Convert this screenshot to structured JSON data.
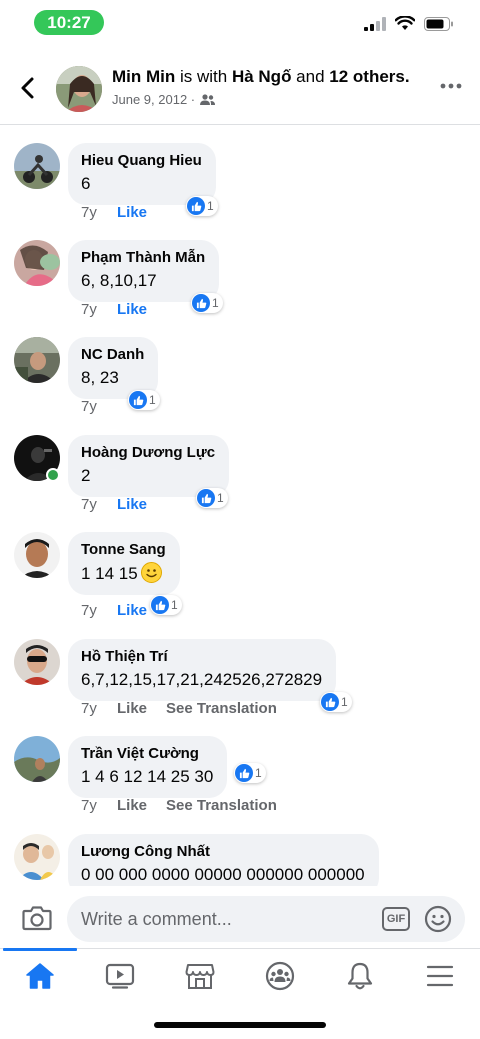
{
  "status_bar": {
    "time": "10:27"
  },
  "header": {
    "poster_name": "Min Min",
    "with_text": " is with ",
    "tagged_name": "Hà Ngố",
    "and_text": " and ",
    "others_text": "12 others.",
    "date": "June 9, 2012 ·",
    "privacy_icon": "friends-icon",
    "back_icon": "chevron-left-icon",
    "more_icon": "ellipsis-icon"
  },
  "comments": [
    {
      "name": "Hieu Quang Hieu",
      "text": "6",
      "age": "7y",
      "like_label": "Like",
      "reaction_count": "1"
    },
    {
      "name": "Phạm Thành Mẫn",
      "text": "6, 8,10,17",
      "age": "7y",
      "like_label": "Like",
      "reaction_count": "1"
    },
    {
      "name": "NC Danh",
      "text": "8, 23",
      "age": "7y",
      "like_label": "",
      "reaction_count": "1"
    },
    {
      "name": "Hoàng Dương Lực",
      "text": "2",
      "age": "7y",
      "like_label": "Like",
      "reaction_count": "1"
    },
    {
      "name": "Tonne Sang",
      "text": "1 14 15",
      "age": "7y",
      "like_label": "Like",
      "reaction_count": "1"
    },
    {
      "name": "Hồ Thiện Trí",
      "text": "6,7,12,15,17,21,242526,272829",
      "age": "7y",
      "like_label": "Like",
      "translation_label": "See Translation",
      "reaction_count": "1"
    },
    {
      "name": "Trần Việt Cường",
      "text": "1 4 6 12 14 25 30",
      "age": "7y",
      "like_label": "Like",
      "translation_label": "See Translation",
      "reaction_count": "1"
    },
    {
      "name": "Lương Công Nhất",
      "text": "0 00 000 0000 00000 000000 000000"
    }
  ],
  "composer": {
    "placeholder": "Write a comment...",
    "gif_label": "GIF",
    "camera_icon": "camera-icon",
    "sticker_icon": "smiley-icon"
  },
  "nav": [
    "home-icon",
    "watch-icon",
    "marketplace-icon",
    "groups-icon",
    "notifications-icon",
    "menu-icon"
  ],
  "colors": {
    "accent": "#1877f2",
    "bubble": "#f0f2f5",
    "secondary_text": "#65676b",
    "status_pill": "#34c759",
    "online": "#31a24c"
  }
}
